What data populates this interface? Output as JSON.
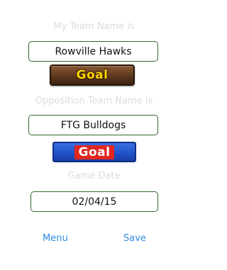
{
  "labels": {
    "my_team": "My Team Name is",
    "opposition_team": "Opposition Team Name is",
    "game_date": "Game Date"
  },
  "fields": {
    "my_team_value": "Rowville Hawks",
    "opposition_team_value": "FTG Bulldogs",
    "game_date_value": "02/04/15"
  },
  "buttons": {
    "my_team_goal": "Goal",
    "opposition_goal": "Goal",
    "menu": "Menu",
    "save": "Save"
  },
  "colors": {
    "field_border": "#2f6b2f",
    "label_text": "#dcdcdc",
    "link_blue": "#2b8be6",
    "goal_brown": "#5b371d",
    "goal_yellow_text": "#ffd400",
    "goal_blue": "#1f4fc9",
    "goal_red": "#e2261e"
  }
}
